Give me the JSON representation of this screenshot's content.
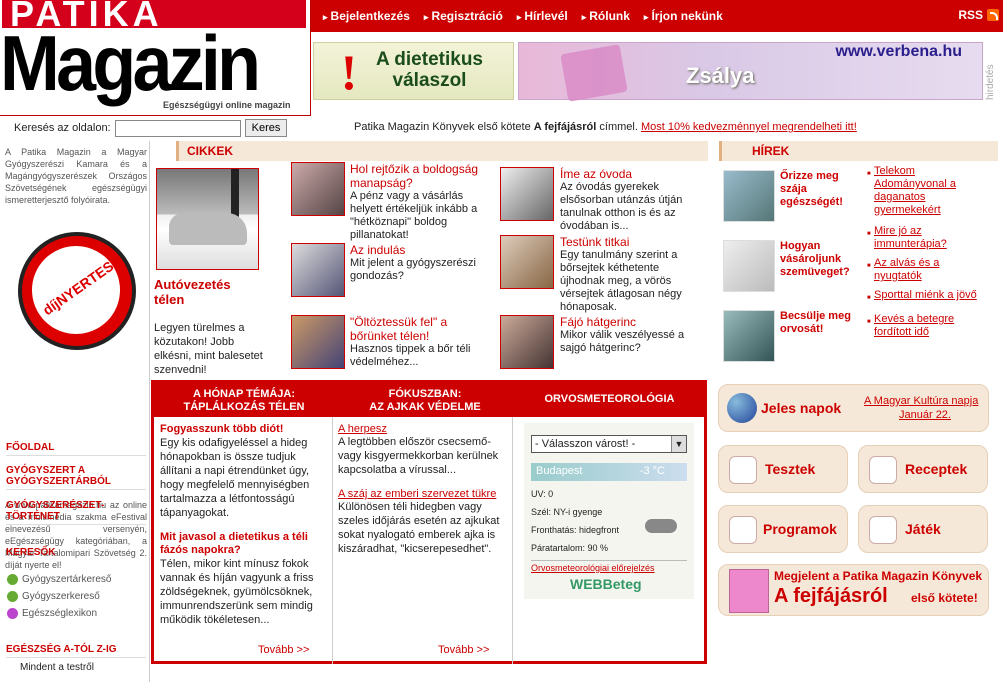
{
  "logo": {
    "top": "PATIKA",
    "main": "Magazin",
    "tagline": "Egészségügyi online magazin"
  },
  "topnav": [
    "Bejelentkezés",
    "Regisztráció",
    "Hírlevél",
    "Rólunk",
    "Írjon nekünk"
  ],
  "rss": "RSS",
  "banner1": {
    "line1": "A dietetikus",
    "line2": "válaszol"
  },
  "banner2": {
    "url": "www.verbena.hu",
    "product": "Zsálya"
  },
  "hirdetes": "hirdetés",
  "search": {
    "label": "Keresés az oldalon:",
    "value": "",
    "button": "Keres"
  },
  "notice": {
    "pre": "Patika Magazin Könyvek első kötete ",
    "bold": "A fejfájásról",
    "post": " címmel. ",
    "link": "Most 10% kedvezménnyel megrendelheti itt!"
  },
  "left": {
    "intro": "A Patika Magazin a Magyar Gyógyszerészi Kamara és a Magángyógyszerészek Országos Szövetségének egészségügyi ismeretterjesztő folyóirata.",
    "award_text": "díjNYERTES",
    "award_desc": "A www.patikamagazin.hu az online és a multimédia szakma eFestival elnevezésű versenyén, eEgészségügy kategóriában, a Magyar Tartalomipari Szövetség 2. díját nyerte el!",
    "menu1": "FŐOLDAL",
    "menu2": "GYÓGYSZERT A GYÓGYSZERTÁRBÓL",
    "menu3": "GYÓGYSZERÉSZET-TÖRTÉNET",
    "menu4": "KERESŐK",
    "links": [
      "Gyógyszertárkereső",
      "Gyógyszerkereső",
      "Egészséglexikon"
    ],
    "menu5": "EGÉSZSÉG A-TÓL Z-IG",
    "sub1": "Mindent a testről"
  },
  "cikkek": {
    "title": "CIKKEK",
    "main": {
      "title": "Autóvezetés télen",
      "desc": "Legyen türelmes a közutakon! Jobb elkésni, mint balesetet szenvedni!"
    },
    "articles": [
      {
        "title": "Hol rejtőzik a boldogság manapság?",
        "desc": "A pénz vagy a vásárlás helyett értékeljük inkább a \"hétköznapi\" boldog pillanatokat!"
      },
      {
        "title": "Az indulás",
        "desc": "Mit jelent a gyógyszerészi gondozás?"
      },
      {
        "title": "\"Öltöztessük fel\" a bőrünket télen!",
        "desc": "Hasznos tippek a bőr téli védelméhez..."
      },
      {
        "title": "Íme az óvoda",
        "desc": "Az óvodás gyerekek elsősorban utánzás útján tanulnak otthon is és az óvodában is..."
      },
      {
        "title": "Testünk titkai",
        "desc": "Egy tanulmány szerint a bőrsejtek kéthetente újhodnak meg, a vörös vérsejtek átlagosan négy hónaposak."
      },
      {
        "title": "Fájó hátgerinc",
        "desc": "Mikor válik veszélyessé a sajgó hátgerinc?"
      }
    ]
  },
  "tabs": {
    "col1": {
      "head1": "A HÓNAP TÉMÁJA:",
      "head2": "TÁPLÁLKOZÁS TÉLEN",
      "t1": "Fogyasszunk több diót!",
      "d1": "Egy kis odafigyeléssel a hideg hónapokban is össze tudjuk állítani a napi étrendünket úgy, hogy megfelelő mennyiségben tartalmazza a létfontosságú tápanyagokat.",
      "t2": "Mit javasol a dietetikus a téli fázós napokra?",
      "d2": "Télen, mikor kint mínusz fokok vannak és híján vagyunk a friss zöldségeknek, gyümölcsöknek, immunrendszerünk sem mindig működik tökéletesen...",
      "more": "Tovább >>"
    },
    "col2": {
      "head1": "FÓKUSZBAN:",
      "head2": "AZ AJKAK VÉDELME",
      "t1": "A herpesz",
      "d1": "A legtöbben először csecsemő-vagy kisgyermekkorban kerülnek kapcsolatba a vírussal...",
      "t2": "A száj az emberi szervezet tükre",
      "d2": "Különösen téli hidegben vagy szeles időjárás esetén az ajkukat sokat nyalogató emberek ajka is kiszáradhat, \"kicserepesedhet\".",
      "more": "Tovább >>"
    },
    "col3": {
      "head": "ORVOSMETEOROLÓGIA",
      "select": "- Válasszon várost! -",
      "city": "Budapest",
      "temp": "-3 °C",
      "uv": "UV: 0",
      "wind": "Szél: NY-i gyenge",
      "front": "Fronthatás: hidegfront",
      "hum": "Páratartalom: 90 %",
      "link": "Orvosmeteorológiai előrejelzés",
      "brand": "WEBBeteg"
    }
  },
  "hirek": {
    "title": "HÍREK",
    "items": [
      "Őrizze meg szája egészségét!",
      "Hogyan vásároljunk szemüveget?",
      "Becsülje meg orvosát!"
    ],
    "bullets": [
      "Telekom Adományvonal a daganatos gyermekekért",
      "Mire jó az immunterápia?",
      "Az alvás és a nyugtatók",
      "Sporttal miénk a jövő",
      "Kevés a betegre fordított idő"
    ]
  },
  "boxes": {
    "jeles": "Jeles napok",
    "jeles_link1": "A Magyar Kultúra napja",
    "jeles_link2": "Január 22.",
    "tesztek": "Tesztek",
    "receptek": "Receptek",
    "programok": "Programok",
    "jatek": "Játék",
    "book1": "Megjelent a Patika Magazin Könyvek",
    "book2": "A fejfájásról",
    "book3": "első kötete!"
  },
  "colors": {
    "accent": "#cc0000",
    "panel": "#f6e8d8"
  }
}
